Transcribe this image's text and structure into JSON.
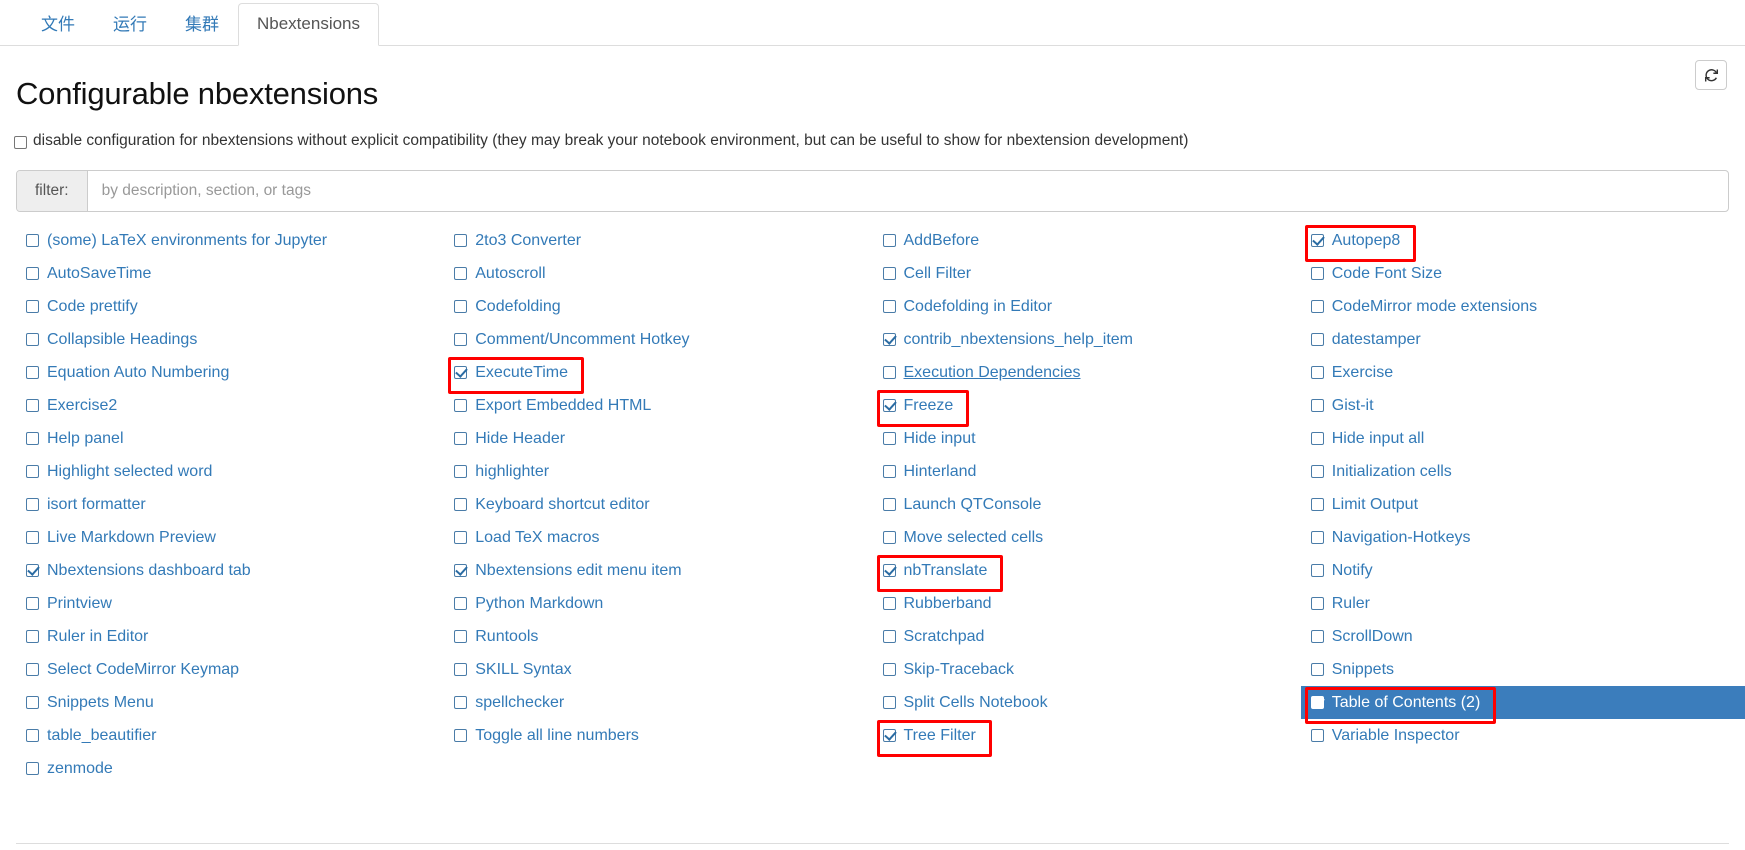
{
  "tabs": [
    {
      "label": "文件",
      "active": false
    },
    {
      "label": "运行",
      "active": false
    },
    {
      "label": "集群",
      "active": false
    },
    {
      "label": "Nbextensions",
      "active": true
    }
  ],
  "toolbar": {
    "refresh_icon": "refresh-icon",
    "refresh_title": "refresh"
  },
  "heading": "Configurable nbextensions",
  "disable_option": {
    "label": "disable configuration for nbextensions without explicit compatibility (they may break your notebook environment, but can be useful to show for nbextension development)",
    "checked": false
  },
  "filter": {
    "label": "filter:",
    "placeholder": "by description, section, or tags",
    "value": ""
  },
  "colors": {
    "link": "#337ab7",
    "selected_bg": "#3b7dbc",
    "annotation": "#ff0000"
  },
  "columns": [
    {
      "items": [
        {
          "label": "(some) LaTeX environments for Jupyter",
          "checked": false,
          "selected": false,
          "highlighted": false,
          "underline": false
        },
        {
          "label": "AutoSaveTime",
          "checked": false,
          "selected": false,
          "highlighted": false,
          "underline": false
        },
        {
          "label": "Code prettify",
          "checked": false,
          "selected": false,
          "highlighted": false,
          "underline": false
        },
        {
          "label": "Collapsible Headings",
          "checked": false,
          "selected": false,
          "highlighted": false,
          "underline": false
        },
        {
          "label": "Equation Auto Numbering",
          "checked": false,
          "selected": false,
          "highlighted": false,
          "underline": false
        },
        {
          "label": "Exercise2",
          "checked": false,
          "selected": false,
          "highlighted": false,
          "underline": false
        },
        {
          "label": "Help panel",
          "checked": false,
          "selected": false,
          "highlighted": false,
          "underline": false
        },
        {
          "label": "Highlight selected word",
          "checked": false,
          "selected": false,
          "highlighted": false,
          "underline": false
        },
        {
          "label": "isort formatter",
          "checked": false,
          "selected": false,
          "highlighted": false,
          "underline": false
        },
        {
          "label": "Live Markdown Preview",
          "checked": false,
          "selected": false,
          "highlighted": false,
          "underline": false
        },
        {
          "label": "Nbextensions dashboard tab",
          "checked": true,
          "selected": false,
          "highlighted": false,
          "underline": false
        },
        {
          "label": "Printview",
          "checked": false,
          "selected": false,
          "highlighted": false,
          "underline": false
        },
        {
          "label": "Ruler in Editor",
          "checked": false,
          "selected": false,
          "highlighted": false,
          "underline": false
        },
        {
          "label": "Select CodeMirror Keymap",
          "checked": false,
          "selected": false,
          "highlighted": false,
          "underline": false
        },
        {
          "label": "Snippets Menu",
          "checked": false,
          "selected": false,
          "highlighted": false,
          "underline": false
        },
        {
          "label": "table_beautifier",
          "checked": false,
          "selected": false,
          "highlighted": false,
          "underline": false
        },
        {
          "label": "zenmode",
          "checked": false,
          "selected": false,
          "highlighted": false,
          "underline": false
        }
      ]
    },
    {
      "items": [
        {
          "label": "2to3 Converter",
          "checked": false,
          "selected": false,
          "highlighted": false,
          "underline": false
        },
        {
          "label": "Autoscroll",
          "checked": false,
          "selected": false,
          "highlighted": false,
          "underline": false
        },
        {
          "label": "Codefolding",
          "checked": false,
          "selected": false,
          "highlighted": false,
          "underline": false
        },
        {
          "label": "Comment/Uncomment Hotkey",
          "checked": false,
          "selected": false,
          "highlighted": false,
          "underline": false
        },
        {
          "label": "ExecuteTime",
          "checked": true,
          "selected": false,
          "highlighted": true,
          "underline": false
        },
        {
          "label": "Export Embedded HTML",
          "checked": false,
          "selected": false,
          "highlighted": false,
          "underline": false
        },
        {
          "label": "Hide Header",
          "checked": false,
          "selected": false,
          "highlighted": false,
          "underline": false
        },
        {
          "label": "highlighter",
          "checked": false,
          "selected": false,
          "highlighted": false,
          "underline": false
        },
        {
          "label": "Keyboard shortcut editor",
          "checked": false,
          "selected": false,
          "highlighted": false,
          "underline": false
        },
        {
          "label": "Load TeX macros",
          "checked": false,
          "selected": false,
          "highlighted": false,
          "underline": false
        },
        {
          "label": "Nbextensions edit menu item",
          "checked": true,
          "selected": false,
          "highlighted": false,
          "underline": false
        },
        {
          "label": "Python Markdown",
          "checked": false,
          "selected": false,
          "highlighted": false,
          "underline": false
        },
        {
          "label": "Runtools",
          "checked": false,
          "selected": false,
          "highlighted": false,
          "underline": false
        },
        {
          "label": "SKILL Syntax",
          "checked": false,
          "selected": false,
          "highlighted": false,
          "underline": false
        },
        {
          "label": "spellchecker",
          "checked": false,
          "selected": false,
          "highlighted": false,
          "underline": false
        },
        {
          "label": "Toggle all line numbers",
          "checked": false,
          "selected": false,
          "highlighted": false,
          "underline": false
        }
      ]
    },
    {
      "items": [
        {
          "label": "AddBefore",
          "checked": false,
          "selected": false,
          "highlighted": false,
          "underline": false
        },
        {
          "label": "Cell Filter",
          "checked": false,
          "selected": false,
          "highlighted": false,
          "underline": false
        },
        {
          "label": "Codefolding in Editor",
          "checked": false,
          "selected": false,
          "highlighted": false,
          "underline": false
        },
        {
          "label": "contrib_nbextensions_help_item",
          "checked": true,
          "selected": false,
          "highlighted": false,
          "underline": false
        },
        {
          "label": "Execution Dependencies",
          "checked": false,
          "selected": false,
          "highlighted": false,
          "underline": true
        },
        {
          "label": "Freeze",
          "checked": true,
          "selected": false,
          "highlighted": true,
          "underline": false
        },
        {
          "label": "Hide input",
          "checked": false,
          "selected": false,
          "highlighted": false,
          "underline": false
        },
        {
          "label": "Hinterland",
          "checked": false,
          "selected": false,
          "highlighted": false,
          "underline": false
        },
        {
          "label": "Launch QTConsole",
          "checked": false,
          "selected": false,
          "highlighted": false,
          "underline": false
        },
        {
          "label": "Move selected cells",
          "checked": false,
          "selected": false,
          "highlighted": false,
          "underline": false
        },
        {
          "label": "nbTranslate",
          "checked": true,
          "selected": false,
          "highlighted": true,
          "underline": false
        },
        {
          "label": "Rubberband",
          "checked": false,
          "selected": false,
          "highlighted": false,
          "underline": false
        },
        {
          "label": "Scratchpad",
          "checked": false,
          "selected": false,
          "highlighted": false,
          "underline": false
        },
        {
          "label": "Skip-Traceback",
          "checked": false,
          "selected": false,
          "highlighted": false,
          "underline": false
        },
        {
          "label": "Split Cells Notebook",
          "checked": false,
          "selected": false,
          "highlighted": false,
          "underline": false
        },
        {
          "label": "Tree Filter",
          "checked": true,
          "selected": false,
          "highlighted": true,
          "underline": false
        }
      ]
    },
    {
      "items": [
        {
          "label": "Autopep8",
          "checked": true,
          "selected": false,
          "highlighted": true,
          "underline": false
        },
        {
          "label": "Code Font Size",
          "checked": false,
          "selected": false,
          "highlighted": false,
          "underline": false
        },
        {
          "label": "CodeMirror mode extensions",
          "checked": false,
          "selected": false,
          "highlighted": false,
          "underline": false
        },
        {
          "label": "datestamper",
          "checked": false,
          "selected": false,
          "highlighted": false,
          "underline": false
        },
        {
          "label": "Exercise",
          "checked": false,
          "selected": false,
          "highlighted": false,
          "underline": false
        },
        {
          "label": "Gist-it",
          "checked": false,
          "selected": false,
          "highlighted": false,
          "underline": false
        },
        {
          "label": "Hide input all",
          "checked": false,
          "selected": false,
          "highlighted": false,
          "underline": false
        },
        {
          "label": "Initialization cells",
          "checked": false,
          "selected": false,
          "highlighted": false,
          "underline": false
        },
        {
          "label": "Limit Output",
          "checked": false,
          "selected": false,
          "highlighted": false,
          "underline": false
        },
        {
          "label": "Navigation-Hotkeys",
          "checked": false,
          "selected": false,
          "highlighted": false,
          "underline": false
        },
        {
          "label": "Notify",
          "checked": false,
          "selected": false,
          "highlighted": false,
          "underline": false
        },
        {
          "label": "Ruler",
          "checked": false,
          "selected": false,
          "highlighted": false,
          "underline": false
        },
        {
          "label": "ScrollDown",
          "checked": false,
          "selected": false,
          "highlighted": false,
          "underline": false
        },
        {
          "label": "Snippets",
          "checked": false,
          "selected": false,
          "highlighted": false,
          "underline": false
        },
        {
          "label": "Table of Contents (2)",
          "checked": true,
          "selected": true,
          "highlighted": true,
          "underline": false
        },
        {
          "label": "Variable Inspector",
          "checked": false,
          "selected": false,
          "highlighted": false,
          "underline": false
        }
      ]
    }
  ]
}
